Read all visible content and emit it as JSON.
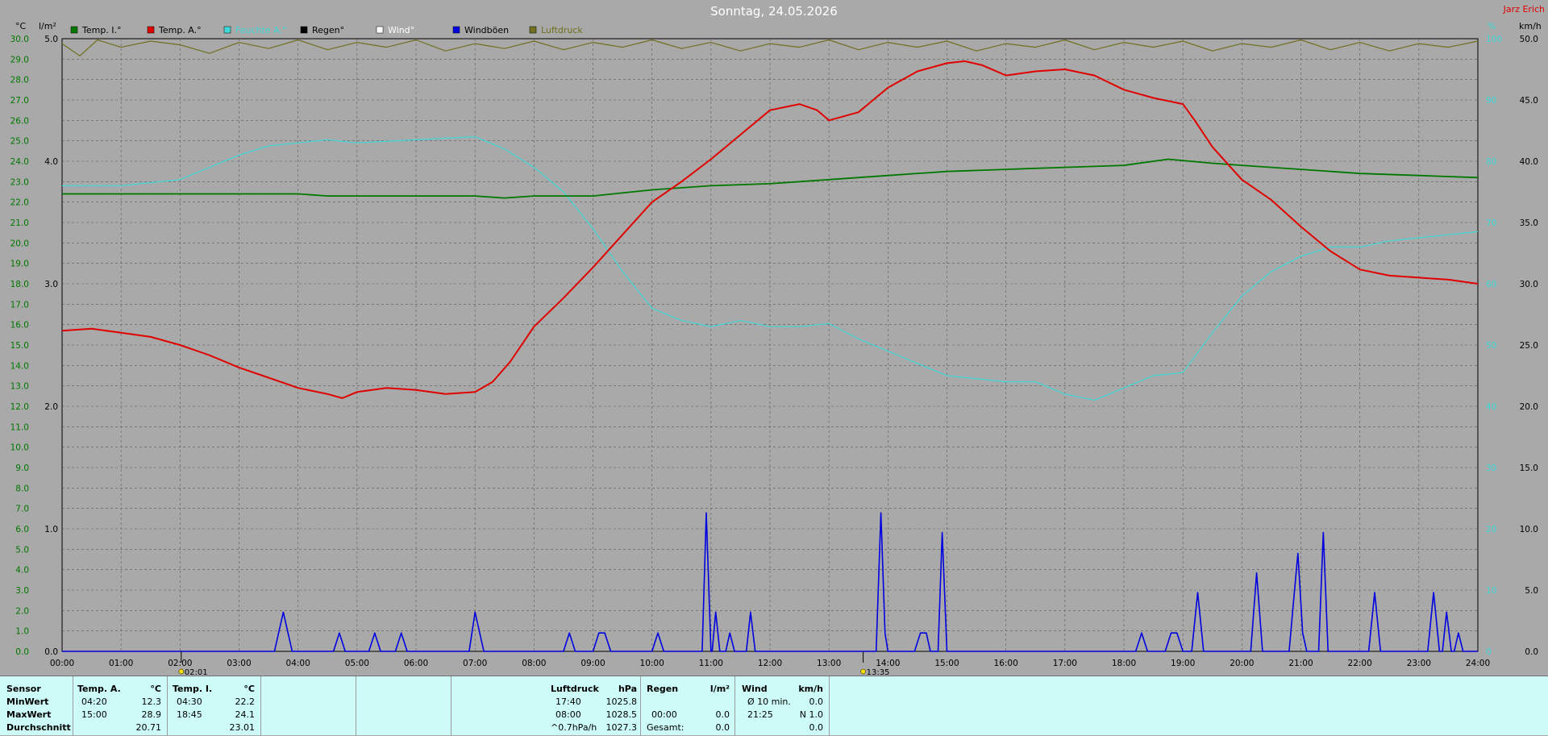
{
  "title": "Sonntag, 24.05.2026",
  "author": "Jarz Erich",
  "colors": {
    "temp_inside": "#007800",
    "temp_outside": "#e00000",
    "humidity": "#40d8d8",
    "rain": "#000000",
    "wind": "#ffffff",
    "gusts": "#0000e0",
    "pressure": "#707020",
    "plot_bg": "#a9a9a9",
    "grid": "#5a5a5a",
    "panel_bg": "#ccfbf8"
  },
  "legend": [
    {
      "label": "Temp. I.°",
      "color": "#007800"
    },
    {
      "label": "Temp. A.°",
      "color": "#e00000"
    },
    {
      "label": "Feuchte A.°",
      "color": "#40d8d8"
    },
    {
      "label": "Regen°",
      "color": "#000000"
    },
    {
      "label": "Wind°",
      "color": "#ffffff"
    },
    {
      "label": "Windböen",
      "color": "#0000e0"
    },
    {
      "label": "Luftdruck",
      "color": "#707020"
    }
  ],
  "chart_data": {
    "type": "line",
    "axes": {
      "temp": {
        "unit": "°C",
        "min": 0,
        "max": 30,
        "step": 1
      },
      "rain": {
        "unit": "l/m²",
        "min": 0,
        "max": 5,
        "ticks": [
          "0.0",
          "1.0",
          "2.0",
          "3.0",
          "4.0",
          "5.0"
        ]
      },
      "humidity": {
        "unit": "%",
        "min": 0,
        "max": 100,
        "ticks": [
          "0",
          "10",
          "20",
          "30",
          "40",
          "50",
          "60",
          "70",
          "80",
          "90",
          "100"
        ]
      },
      "wind": {
        "unit": "km/h",
        "min": 0,
        "max": 50,
        "ticks": [
          "0.0",
          "5.0",
          "10.0",
          "15.0",
          "20.0",
          "25.0",
          "30.0",
          "35.0",
          "40.0",
          "45.0",
          "50.0"
        ]
      },
      "x_hours": [
        "00:00",
        "01:00",
        "02:00",
        "03:00",
        "04:00",
        "05:00",
        "06:00",
        "07:00",
        "08:00",
        "09:00",
        "10:00",
        "11:00",
        "12:00",
        "13:00",
        "14:00",
        "15:00",
        "16:00",
        "17:00",
        "18:00",
        "19:00",
        "20:00",
        "21:00",
        "22:00",
        "23:00",
        "24:00"
      ]
    },
    "markers": [
      {
        "time": 2.02,
        "label": "02:01"
      },
      {
        "time": 13.58,
        "label": "13:35"
      }
    ],
    "series": [
      {
        "name": "Temp. A.°",
        "axis": "temp",
        "color": "#e00000",
        "points": [
          [
            0,
            15.7
          ],
          [
            0.5,
            15.8
          ],
          [
            1,
            15.6
          ],
          [
            1.5,
            15.4
          ],
          [
            2,
            15.0
          ],
          [
            2.5,
            14.5
          ],
          [
            3,
            13.9
          ],
          [
            3.5,
            13.4
          ],
          [
            4,
            12.9
          ],
          [
            4.5,
            12.6
          ],
          [
            4.75,
            12.4
          ],
          [
            5,
            12.7
          ],
          [
            5.5,
            12.9
          ],
          [
            6,
            12.8
          ],
          [
            6.5,
            12.6
          ],
          [
            7,
            12.7
          ],
          [
            7.3,
            13.2
          ],
          [
            7.6,
            14.2
          ],
          [
            8,
            15.9
          ],
          [
            8.5,
            17.3
          ],
          [
            9,
            18.8
          ],
          [
            9.5,
            20.4
          ],
          [
            10,
            22.0
          ],
          [
            10.5,
            23.0
          ],
          [
            11,
            24.1
          ],
          [
            11.5,
            25.3
          ],
          [
            12,
            26.5
          ],
          [
            12.5,
            26.8
          ],
          [
            12.8,
            26.5
          ],
          [
            13,
            26.0
          ],
          [
            13.5,
            26.4
          ],
          [
            14,
            27.6
          ],
          [
            14.5,
            28.4
          ],
          [
            15,
            28.8
          ],
          [
            15.3,
            28.9
          ],
          [
            15.6,
            28.7
          ],
          [
            16,
            28.2
          ],
          [
            16.5,
            28.4
          ],
          [
            17,
            28.5
          ],
          [
            17.5,
            28.2
          ],
          [
            18,
            27.5
          ],
          [
            18.5,
            27.1
          ],
          [
            19,
            26.8
          ],
          [
            19.2,
            26.0
          ],
          [
            19.5,
            24.7
          ],
          [
            20,
            23.1
          ],
          [
            20.5,
            22.1
          ],
          [
            21,
            20.8
          ],
          [
            21.5,
            19.6
          ],
          [
            22,
            18.7
          ],
          [
            22.5,
            18.4
          ],
          [
            23,
            18.3
          ],
          [
            23.5,
            18.2
          ],
          [
            24,
            18.0
          ]
        ]
      },
      {
        "name": "Temp. I.°",
        "axis": "temp",
        "color": "#007800",
        "points": [
          [
            0,
            22.4
          ],
          [
            1,
            22.4
          ],
          [
            2,
            22.4
          ],
          [
            3,
            22.4
          ],
          [
            4,
            22.4
          ],
          [
            4.5,
            22.3
          ],
          [
            5,
            22.3
          ],
          [
            6,
            22.3
          ],
          [
            7,
            22.3
          ],
          [
            7.5,
            22.2
          ],
          [
            8,
            22.3
          ],
          [
            9,
            22.3
          ],
          [
            10,
            22.6
          ],
          [
            11,
            22.8
          ],
          [
            12,
            22.9
          ],
          [
            13,
            23.1
          ],
          [
            14,
            23.3
          ],
          [
            15,
            23.5
          ],
          [
            16,
            23.6
          ],
          [
            17,
            23.7
          ],
          [
            18,
            23.8
          ],
          [
            18.75,
            24.1
          ],
          [
            19.5,
            23.9
          ],
          [
            20,
            23.8
          ],
          [
            21,
            23.6
          ],
          [
            22,
            23.4
          ],
          [
            23,
            23.3
          ],
          [
            24,
            23.2
          ]
        ]
      },
      {
        "name": "Feuchte A.°",
        "axis": "humidity",
        "color": "#40d8d8",
        "points": [
          [
            0,
            76
          ],
          [
            1,
            76
          ],
          [
            2,
            77
          ],
          [
            2.5,
            79
          ],
          [
            3,
            81
          ],
          [
            3.5,
            82.5
          ],
          [
            4,
            83
          ],
          [
            4.5,
            83.5
          ],
          [
            5,
            83
          ],
          [
            6,
            83.5
          ],
          [
            7,
            84
          ],
          [
            7.5,
            82
          ],
          [
            8,
            79
          ],
          [
            8.5,
            75
          ],
          [
            9,
            69
          ],
          [
            9.5,
            62
          ],
          [
            10,
            56
          ],
          [
            10.5,
            54
          ],
          [
            11,
            53
          ],
          [
            11.5,
            54
          ],
          [
            12,
            53
          ],
          [
            12.5,
            53
          ],
          [
            13,
            53.5
          ],
          [
            13.5,
            51
          ],
          [
            14,
            49
          ],
          [
            14.5,
            47
          ],
          [
            15,
            45
          ],
          [
            16,
            44
          ],
          [
            16.5,
            44
          ],
          [
            17,
            42
          ],
          [
            17.5,
            41
          ],
          [
            18,
            43
          ],
          [
            18.5,
            45
          ],
          [
            19,
            45.5
          ],
          [
            19.5,
            52
          ],
          [
            20,
            58
          ],
          [
            20.5,
            62
          ],
          [
            21,
            64.5
          ],
          [
            21.5,
            66
          ],
          [
            22,
            66
          ],
          [
            22.5,
            67
          ],
          [
            23,
            67.5
          ],
          [
            23.5,
            68
          ],
          [
            24,
            68.5
          ]
        ]
      },
      {
        "name": "Windböen",
        "axis": "wind",
        "color": "#0000e0",
        "points": [
          [
            0,
            0
          ],
          [
            3.6,
            0
          ],
          [
            3.75,
            3.2
          ],
          [
            3.9,
            0
          ],
          [
            4.6,
            0
          ],
          [
            4.7,
            1.5
          ],
          [
            4.8,
            0
          ],
          [
            5.2,
            0
          ],
          [
            5.3,
            1.5
          ],
          [
            5.4,
            0
          ],
          [
            5.65,
            0
          ],
          [
            5.75,
            1.5
          ],
          [
            5.85,
            0
          ],
          [
            6.9,
            0
          ],
          [
            7.0,
            3.2
          ],
          [
            7.15,
            0
          ],
          [
            8.5,
            0
          ],
          [
            8.6,
            1.5
          ],
          [
            8.7,
            0
          ],
          [
            9.0,
            0
          ],
          [
            9.1,
            1.5
          ],
          [
            9.2,
            1.5
          ],
          [
            9.3,
            0
          ],
          [
            10,
            0
          ],
          [
            10.1,
            1.5
          ],
          [
            10.2,
            0
          ],
          [
            10.85,
            0
          ],
          [
            10.92,
            11.3
          ],
          [
            11.0,
            0
          ],
          [
            11.02,
            0
          ],
          [
            11.08,
            3.2
          ],
          [
            11.15,
            0
          ],
          [
            11.25,
            0
          ],
          [
            11.32,
            1.5
          ],
          [
            11.4,
            0
          ],
          [
            11.6,
            0
          ],
          [
            11.67,
            3.2
          ],
          [
            11.75,
            0
          ],
          [
            13.8,
            0
          ],
          [
            13.88,
            11.3
          ],
          [
            13.95,
            1.5
          ],
          [
            14.0,
            0
          ],
          [
            14.45,
            0
          ],
          [
            14.55,
            1.5
          ],
          [
            14.65,
            1.5
          ],
          [
            14.72,
            0
          ],
          [
            14.85,
            0
          ],
          [
            14.92,
            9.7
          ],
          [
            15.0,
            0
          ],
          [
            18.2,
            0
          ],
          [
            18.3,
            1.5
          ],
          [
            18.4,
            0
          ],
          [
            18.7,
            0
          ],
          [
            18.8,
            1.5
          ],
          [
            18.9,
            1.5
          ],
          [
            19.0,
            0
          ],
          [
            19.15,
            0
          ],
          [
            19.25,
            4.8
          ],
          [
            19.35,
            0
          ],
          [
            20.15,
            0
          ],
          [
            20.25,
            6.4
          ],
          [
            20.35,
            0
          ],
          [
            20.8,
            0
          ],
          [
            20.88,
            4.3
          ],
          [
            20.95,
            8.0
          ],
          [
            21.03,
            1.5
          ],
          [
            21.1,
            0
          ],
          [
            21.3,
            0
          ],
          [
            21.38,
            9.7
          ],
          [
            21.46,
            0
          ],
          [
            22.15,
            0
          ],
          [
            22.25,
            4.8
          ],
          [
            22.35,
            0
          ],
          [
            23.15,
            0
          ],
          [
            23.25,
            4.8
          ],
          [
            23.35,
            0
          ],
          [
            23.4,
            0
          ],
          [
            23.47,
            3.2
          ],
          [
            23.55,
            0
          ],
          [
            23.6,
            0
          ],
          [
            23.67,
            1.5
          ],
          [
            23.75,
            0
          ],
          [
            24,
            0
          ]
        ]
      },
      {
        "name": "Luftdruck",
        "axis": "rain",
        "color": "#707020",
        "points": [
          [
            0,
            4.96
          ],
          [
            0.3,
            4.86
          ],
          [
            0.6,
            4.99
          ],
          [
            1.0,
            4.93
          ],
          [
            1.5,
            4.98
          ],
          [
            2.0,
            4.95
          ],
          [
            2.5,
            4.88
          ],
          [
            3.0,
            4.97
          ],
          [
            3.5,
            4.92
          ],
          [
            4.0,
            4.99
          ],
          [
            4.5,
            4.91
          ],
          [
            5.0,
            4.97
          ],
          [
            5.5,
            4.93
          ],
          [
            6.0,
            4.99
          ],
          [
            6.5,
            4.9
          ],
          [
            7.0,
            4.96
          ],
          [
            7.5,
            4.92
          ],
          [
            8.0,
            4.98
          ],
          [
            8.5,
            4.91
          ],
          [
            9.0,
            4.97
          ],
          [
            9.5,
            4.93
          ],
          [
            10.0,
            4.99
          ],
          [
            10.5,
            4.92
          ],
          [
            11.0,
            4.97
          ],
          [
            11.5,
            4.9
          ],
          [
            12.0,
            4.96
          ],
          [
            12.5,
            4.93
          ],
          [
            13.0,
            4.99
          ],
          [
            13.5,
            4.91
          ],
          [
            14.0,
            4.97
          ],
          [
            14.5,
            4.93
          ],
          [
            15.0,
            4.98
          ],
          [
            15.5,
            4.9
          ],
          [
            16.0,
            4.96
          ],
          [
            16.5,
            4.93
          ],
          [
            17.0,
            4.99
          ],
          [
            17.5,
            4.91
          ],
          [
            18.0,
            4.97
          ],
          [
            18.5,
            4.93
          ],
          [
            19.0,
            4.98
          ],
          [
            19.5,
            4.9
          ],
          [
            20.0,
            4.96
          ],
          [
            20.5,
            4.93
          ],
          [
            21.0,
            4.99
          ],
          [
            21.5,
            4.91
          ],
          [
            22.0,
            4.97
          ],
          [
            22.5,
            4.9
          ],
          [
            23.0,
            4.96
          ],
          [
            23.5,
            4.93
          ],
          [
            24,
            4.98
          ]
        ]
      }
    ]
  },
  "stats": {
    "sensor": {
      "header": "Sensor",
      "rows": [
        "MinWert",
        "MaxWert",
        "Durchschnitt"
      ]
    },
    "temp_a": {
      "header": "Temp. A.",
      "unit": "°C",
      "min_time": "04:20",
      "min": "12.3",
      "max_time": "15:00",
      "max": "28.9",
      "avg": "20.71"
    },
    "temp_i": {
      "header": "Temp. I.",
      "unit": "°C",
      "min_time": "04:30",
      "min": "22.2",
      "max_time": "18:45",
      "max": "24.1",
      "avg": "23.01"
    },
    "pressure": {
      "header": "Luftdruck",
      "unit": "hPa",
      "min_time": "17:40",
      "min": "1025.8",
      "max_time": "08:00",
      "max": "1028.5",
      "trend_label": "^0.7hPa/h",
      "current": "1027.3"
    },
    "rain": {
      "header": "Regen",
      "unit": "l/m²",
      "row2_time": "00:00",
      "row2_val": "0.0",
      "row3_label": "Gesamt:",
      "row3_val": "0.0"
    },
    "wind": {
      "header": "Wind",
      "unit": "km/h",
      "row1_label": "Ø 10 min.",
      "row1_val": "0.0",
      "row2_time": "21:25",
      "row2_val": "N 1.0",
      "row3_val": "0.0"
    }
  }
}
